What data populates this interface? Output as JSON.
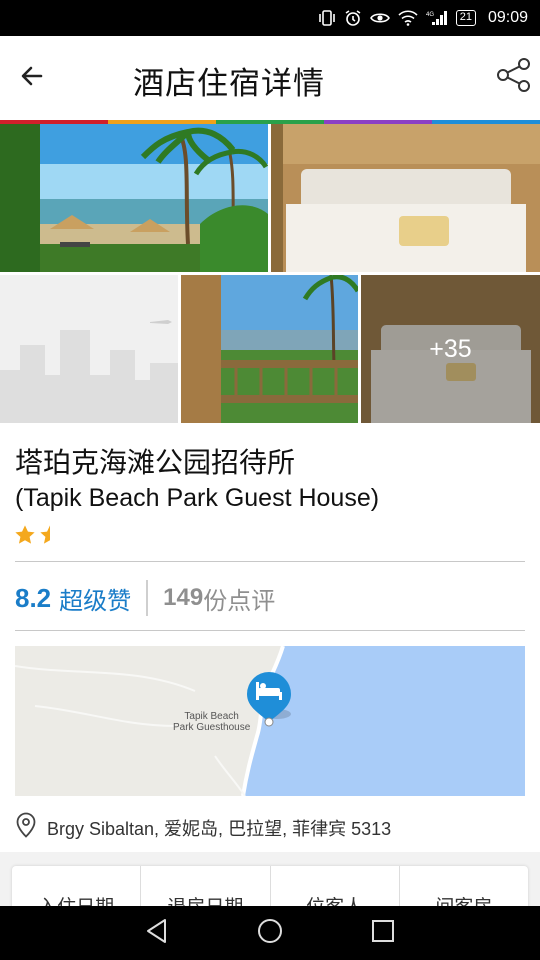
{
  "status_bar": {
    "battery": "21",
    "time": "09:09",
    "icons": [
      "vibrate-icon",
      "alarm-icon",
      "eye-icon",
      "wifi-icon",
      "signal-4g-icon",
      "battery-icon"
    ]
  },
  "header": {
    "title": "酒店住宿详情",
    "back_icon": "back-arrow-icon",
    "share_icon": "share-icon"
  },
  "accent_colors": [
    "#d0202b",
    "#f0a11a",
    "#2aa14a",
    "#8b3fc4",
    "#1f8ed8"
  ],
  "gallery": {
    "more_label": "+35"
  },
  "hotel": {
    "name_cn": "塔珀克海滩公园招待所",
    "name_en": "(Tapik Beach Park Guest House)",
    "stars": 1.5
  },
  "rating": {
    "score": "8.2",
    "score_word": "超级赞",
    "review_count": "149",
    "review_label": "份点评"
  },
  "map": {
    "label_line1": "Tapik Beach",
    "label_line2": "Park Guesthouse"
  },
  "address": "Brgy Sibaltan, 爱妮岛, 巴拉望, 菲律宾 5313",
  "booking": {
    "checkin": "入住日期",
    "checkout": "退房日期",
    "guests": "位客人",
    "rooms": "间客房"
  }
}
